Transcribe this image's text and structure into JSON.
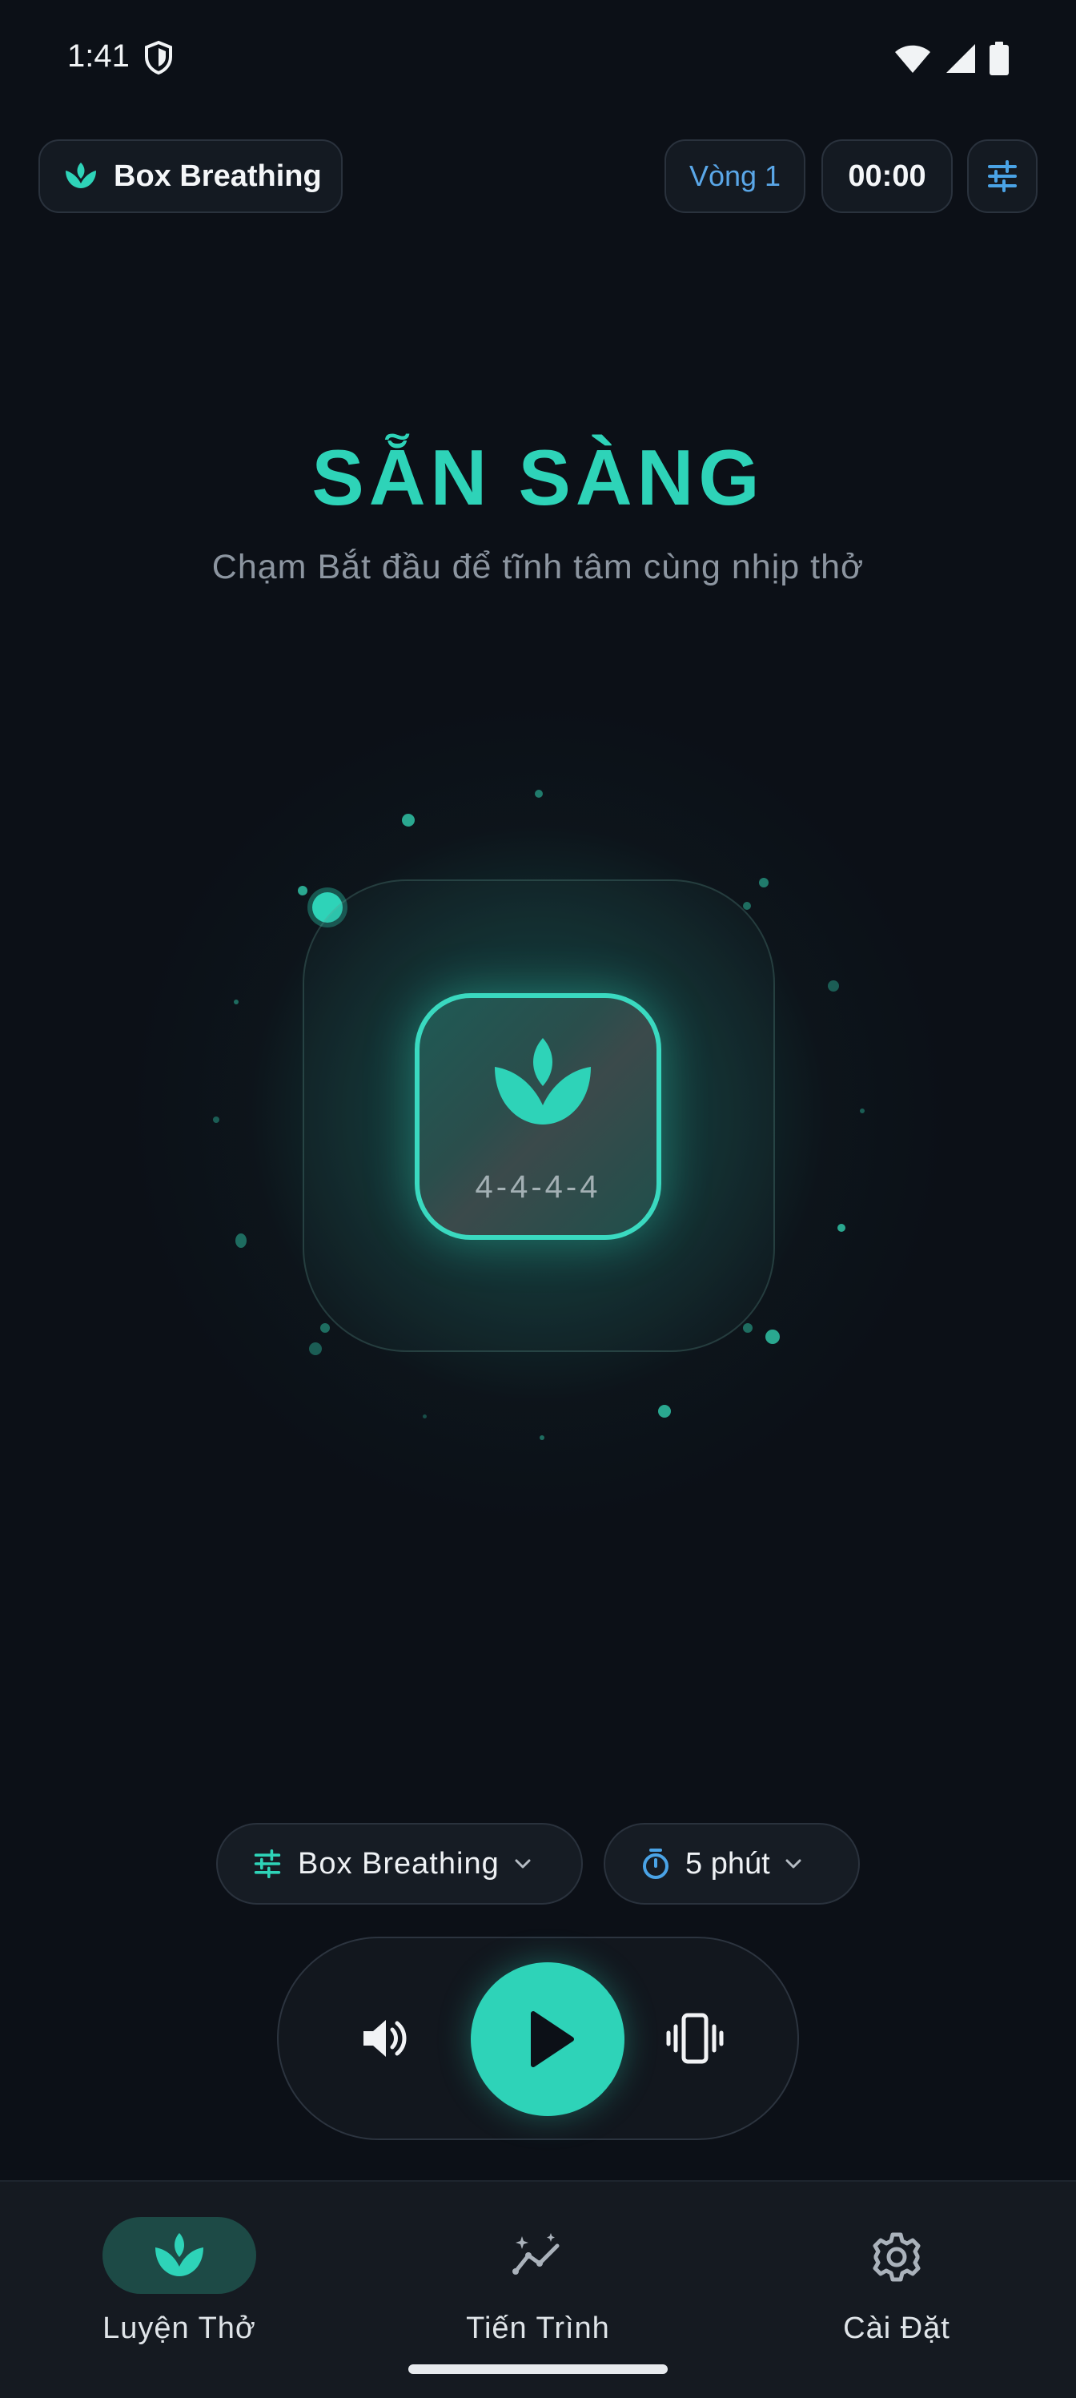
{
  "status_bar": {
    "time": "1:41"
  },
  "header": {
    "mode_label": "Box Breathing",
    "round_label": "Vòng 1",
    "timer": "00:00"
  },
  "main": {
    "title": "SẴN SÀNG",
    "subtitle": "Chạm Bắt đầu để tĩnh tâm cùng nhịp thở",
    "pattern": "4-4-4-4"
  },
  "controls": {
    "preset_label": "Box Breathing",
    "duration_label": "5 phút"
  },
  "nav": {
    "items": [
      {
        "label": "Luyện Thở",
        "icon": "lotus-icon",
        "active": true
      },
      {
        "label": "Tiến Trình",
        "icon": "progress-chart-icon",
        "active": false
      },
      {
        "label": "Cài Đặt",
        "icon": "gear-icon",
        "active": false
      }
    ]
  },
  "colors": {
    "accent": "#2ed3b8",
    "secondary": "#5aa7e8",
    "background": "#0c1017",
    "nav_background": "#151a21"
  }
}
